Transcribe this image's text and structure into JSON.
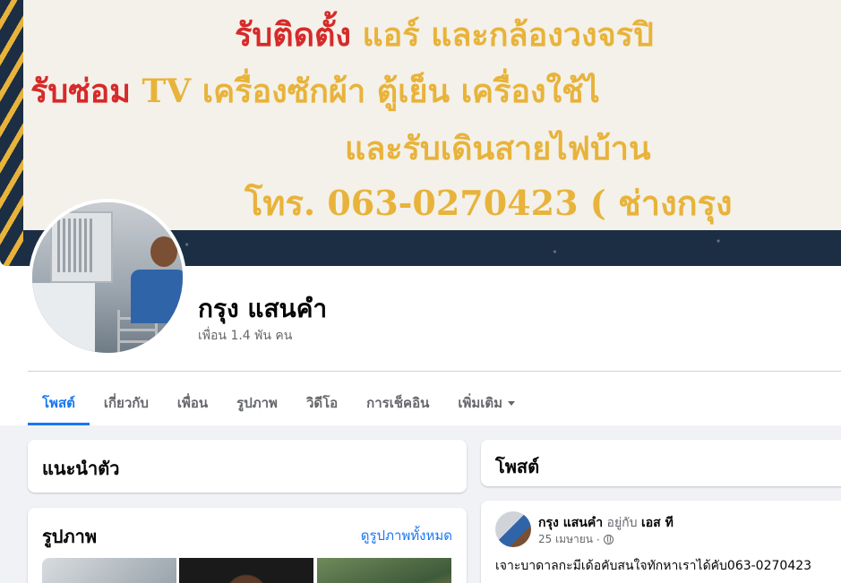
{
  "cover": {
    "line1_red": "รับติดตั้ง",
    "line1_gold": " แอร์ และกล้องวงจรปิ",
    "line2_red": "รับซ่อม",
    "line2_gold": " TV เครื่องซักผ้า ตู้เย็น เครื่องใช้ไ",
    "line3": "และรับเดินสายไฟบ้าน",
    "line4": "โทร. 063-0270423 ( ช่างกรุง",
    "colors": {
      "red": "#d62a2a",
      "gold": "#e8b33a",
      "navy": "#1c2e44"
    }
  },
  "profile": {
    "name": "กรุง แสนคำ",
    "friends": "เพื่อน 1.4 พัน คน"
  },
  "tabs": [
    {
      "label": "โพสต์",
      "active": true
    },
    {
      "label": "เกี่ยวกับ"
    },
    {
      "label": "เพื่อน"
    },
    {
      "label": "รูปภาพ"
    },
    {
      "label": "วิดีโอ"
    },
    {
      "label": "การเช็คอิน"
    },
    {
      "label": "เพิ่มเติม",
      "dropdown": true
    }
  ],
  "intro": {
    "title": "แนะนำตัว"
  },
  "photos": {
    "title": "รูปภาพ",
    "see_all": "ดูรูปภาพทั้งหมด"
  },
  "posts": {
    "title": "โพสต์"
  },
  "post": {
    "author": "กรุง แสนคำ",
    "with_text": "อยู่กับ",
    "tagged": "เอส ที",
    "date": "25 เมษายน",
    "separator": "·",
    "privacy_icon": "globe-icon",
    "text": "เจาะบาดาลกะมีเด้อคับสนใจทักหาเราได้คับ063-0270423"
  },
  "accent_color": "#1877f2"
}
